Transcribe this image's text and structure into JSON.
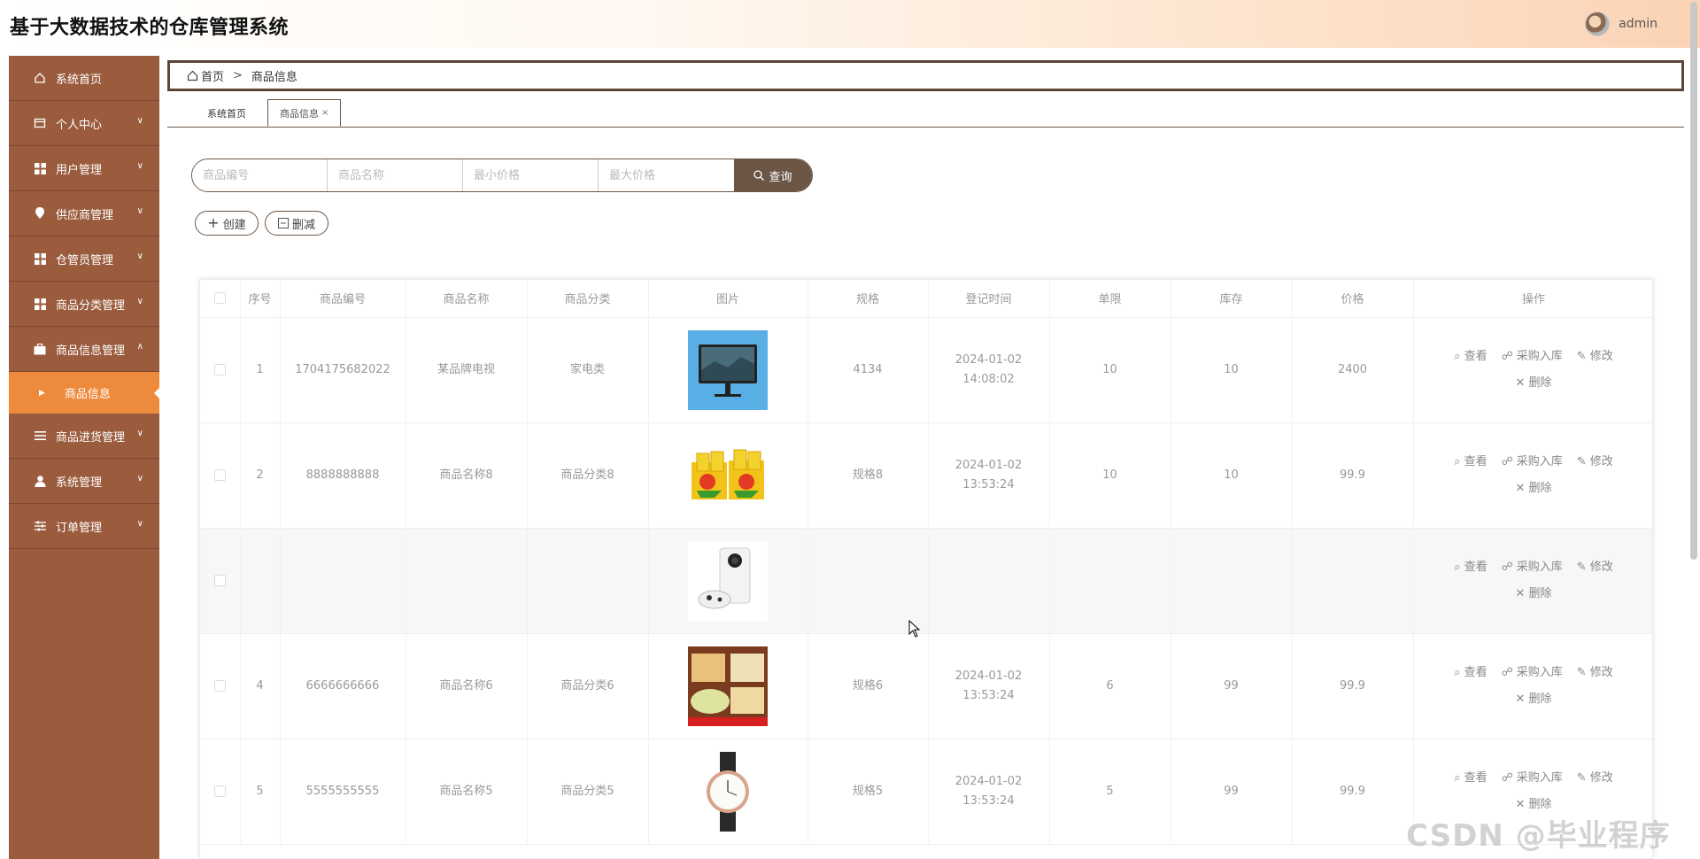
{
  "header": {
    "title": "基于大数据技术的仓库管理系统",
    "username": "admin"
  },
  "sidebar": {
    "items": [
      {
        "label": "系统首页",
        "icon": "home-icon",
        "expandable": false
      },
      {
        "label": "个人中心",
        "icon": "card-icon",
        "expandable": true
      },
      {
        "label": "用户管理",
        "icon": "grid-icon",
        "expandable": true
      },
      {
        "label": "供应商管理",
        "icon": "pin-icon",
        "expandable": true
      },
      {
        "label": "仓管员管理",
        "icon": "grid-icon",
        "expandable": true
      },
      {
        "label": "商品分类管理",
        "icon": "grid-icon",
        "expandable": true
      },
      {
        "label": "商品信息管理",
        "icon": "briefcase-icon",
        "expandable": true,
        "expanded": true
      },
      {
        "label": "商品进货管理",
        "icon": "list-icon",
        "expandable": true
      },
      {
        "label": "系统管理",
        "icon": "user-icon",
        "expandable": true
      },
      {
        "label": "订单管理",
        "icon": "sliders-icon",
        "expandable": true
      }
    ],
    "sub_item": {
      "label": "商品信息"
    }
  },
  "breadcrumb": {
    "home": "首页",
    "separator": ">",
    "current": "商品信息"
  },
  "tabs": [
    {
      "label": "系统首页"
    },
    {
      "label": "商品信息",
      "close": "×"
    }
  ],
  "search": {
    "code_placeholder": "商品编号",
    "name_placeholder": "商品名称",
    "min_price_placeholder": "最小价格",
    "max_price_placeholder": "最大价格",
    "button_label": "查询"
  },
  "actions": {
    "create_label": "创建",
    "delete_label": "删减"
  },
  "table": {
    "columns": [
      "序号",
      "商品编号",
      "商品名称",
      "商品分类",
      "图片",
      "规格",
      "登记时间",
      "单限",
      "库存",
      "价格",
      "操作"
    ],
    "ops": {
      "view": "查看",
      "purchase": "采购入库",
      "edit": "修改",
      "delete": "删除"
    },
    "rows": [
      {
        "index": "1",
        "code": "1704175682022",
        "name": "某品牌电视",
        "category": "家电类",
        "image": "tv-image",
        "spec": "4134",
        "time": "2024-01-02 14:08:02",
        "limit": "10",
        "stock": "10",
        "price": "2400"
      },
      {
        "index": "2",
        "code": "8888888888",
        "name": "商品名称8",
        "category": "商品分类8",
        "image": "drinks-image",
        "spec": "规格8",
        "time": "2024-01-02 13:53:24",
        "limit": "10",
        "stock": "10",
        "price": "99.9"
      },
      {
        "index": "",
        "code": "",
        "name": "",
        "category": "",
        "image": "console-image",
        "spec": "",
        "time": "",
        "limit": "",
        "stock": "",
        "price": ""
      },
      {
        "index": "4",
        "code": "6666666666",
        "name": "商品名称6",
        "category": "商品分类6",
        "image": "cake-image",
        "spec": "规格6",
        "time": "2024-01-02 13:53:24",
        "limit": "6",
        "stock": "99",
        "price": "99.9"
      },
      {
        "index": "5",
        "code": "5555555555",
        "name": "商品名称5",
        "category": "商品分类5",
        "image": "watch-image",
        "spec": "规格5",
        "time": "2024-01-02 13:53:24",
        "limit": "5",
        "stock": "99",
        "price": "99.9"
      }
    ]
  },
  "watermark": "CSDN @毕业程序员",
  "colors": {
    "sidebar": "#9b5c3e",
    "sidebar_active": "#ee8a3c",
    "accent": "#6b5545"
  }
}
